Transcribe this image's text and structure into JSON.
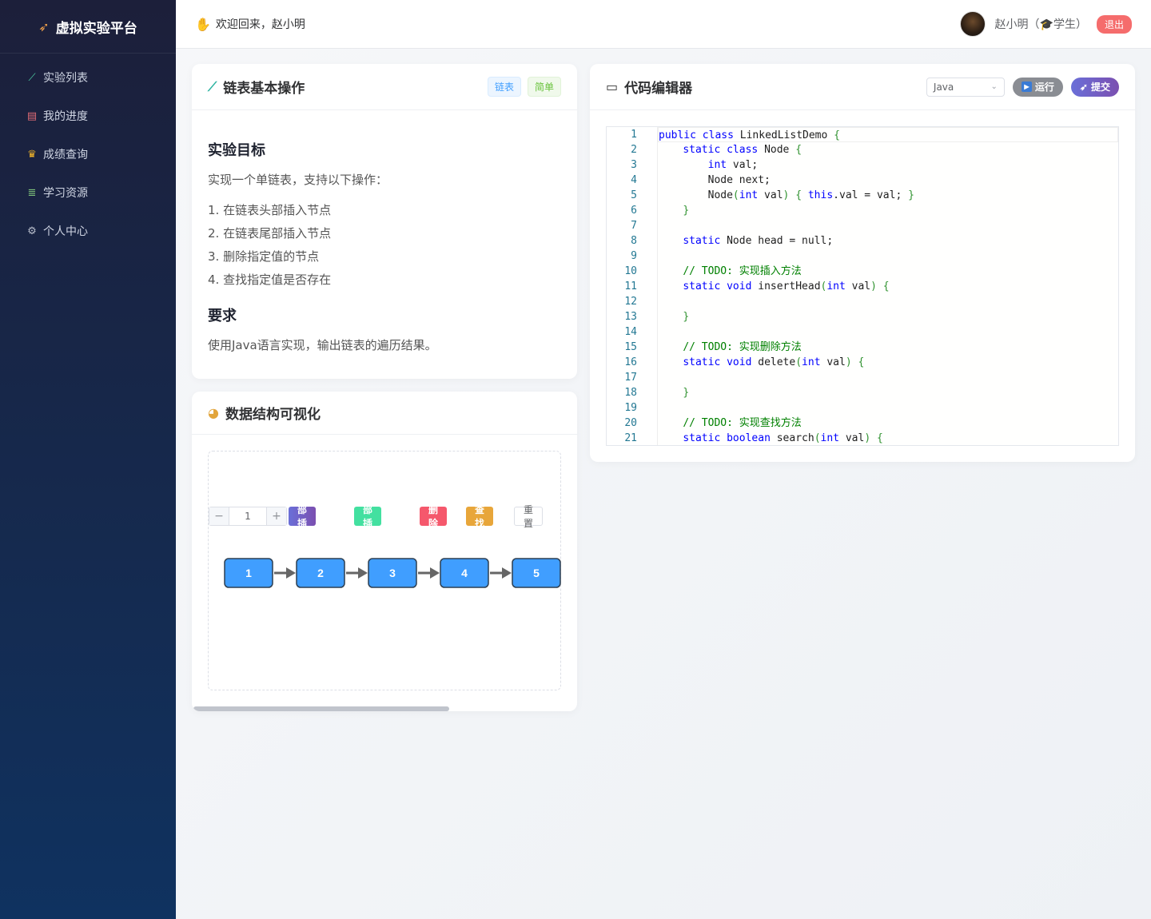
{
  "sidebar": {
    "brand": "虚拟实验平台",
    "brand_icon": "rocket-icon",
    "items": [
      {
        "label": "实验列表",
        "icon": "test-tube-icon"
      },
      {
        "label": "我的进度",
        "icon": "chart-icon"
      },
      {
        "label": "成绩查询",
        "icon": "trophy-icon"
      },
      {
        "label": "学习资源",
        "icon": "books-icon"
      },
      {
        "label": "个人中心",
        "icon": "gear-icon"
      }
    ]
  },
  "header": {
    "welcome": "欢迎回来，赵小明",
    "user_label": "赵小明（🎓学生）",
    "logout": "退出"
  },
  "task": {
    "title": "链表基本操作",
    "tags": [
      "链表",
      "简单"
    ],
    "goal_heading": "实验目标",
    "intro": "实现一个单链表，支持以下操作：",
    "steps": [
      "1. 在链表头部插入节点",
      "2. 在链表尾部插入节点",
      "3. 删除指定值的节点",
      "4. 查找指定值是否存在"
    ],
    "req_heading": "要求",
    "requirement": "使用Java语言实现，输出链表的遍历结果。"
  },
  "viz": {
    "title": "数据结构可视化",
    "stepper_value": "1",
    "minus": "−",
    "plus": "+",
    "buttons": {
      "head": "头部插入",
      "tail": "尾部插入",
      "delete": "删除",
      "find": "查找",
      "reset": "重置"
    },
    "nodes": [
      "1",
      "2",
      "3",
      "4",
      "5"
    ],
    "node_color": "#409eff"
  },
  "editor": {
    "title": "代码编辑器",
    "language": "Java",
    "run": "运行",
    "submit": "提交",
    "lines": [
      "public class LinkedListDemo {",
      "    static class Node {",
      "        int val;",
      "        Node next;",
      "        Node(int val) { this.val = val; }",
      "    }",
      "",
      "    static Node head = null;",
      "",
      "    // TODO: 实现插入方法",
      "    static void insertHead(int val) {",
      "",
      "    }",
      "",
      "    // TODO: 实现删除方法",
      "    static void delete(int val) {",
      "",
      "    }",
      "",
      "    // TODO: 实现查找方法",
      "    static boolean search(int val) {"
    ]
  }
}
